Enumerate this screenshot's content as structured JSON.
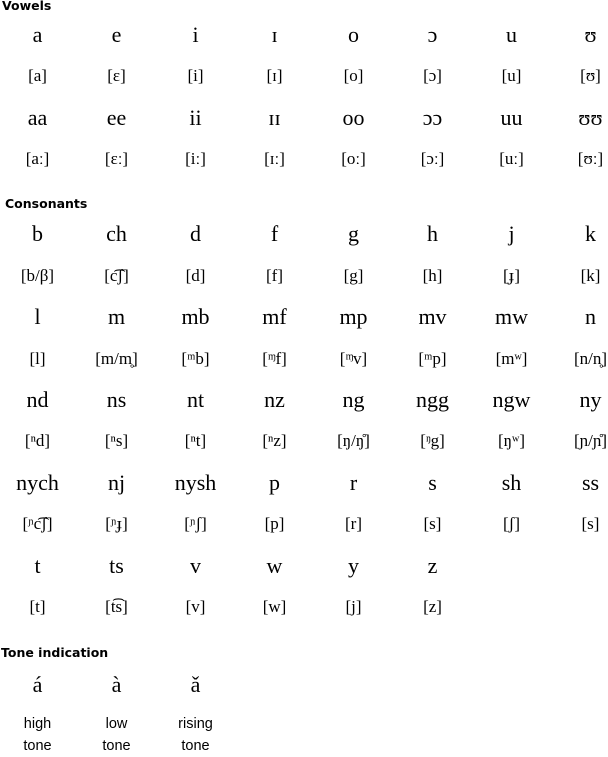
{
  "sections": {
    "vowels": {
      "heading": "Vowels",
      "rows": [
        {
          "type": "letter",
          "cells": [
            "a",
            "e",
            "i",
            "ɪ",
            "o",
            "ɔ",
            "u",
            "ʊ"
          ]
        },
        {
          "type": "ipa",
          "cells": [
            "[a]",
            "[ɛ]",
            "[i]",
            "[ɪ]",
            "[o]",
            "[ɔ]",
            "[u]",
            "[ʊ]"
          ]
        },
        {
          "type": "letter",
          "cells": [
            "aa",
            "ee",
            "ii",
            "ɪɪ",
            "oo",
            "ɔɔ",
            "uu",
            "ʊʊ"
          ]
        },
        {
          "type": "ipa",
          "cells": [
            "[aː]",
            "[ɛː]",
            "[iː]",
            "[ɪː]",
            "[oː]",
            "[ɔː]",
            "[uː]",
            "[ʊː]"
          ]
        }
      ]
    },
    "consonants": {
      "heading": "Consonants",
      "rows": [
        {
          "type": "letter",
          "cells": [
            "b",
            "ch",
            "d",
            "f",
            "g",
            "h",
            "j",
            "k"
          ]
        },
        {
          "type": "ipa",
          "cells": [
            "[b/β]",
            "[c͡ʃ]",
            "[d]",
            "[f]",
            "[g]",
            "[h]",
            "[ɟ]",
            "[k]"
          ]
        },
        {
          "type": "letter",
          "cells": [
            "l",
            "m",
            "mb",
            "mf",
            "mp",
            "mv",
            "mw",
            "n"
          ]
        },
        {
          "type": "ipa",
          "cells": [
            "[l]",
            "[m/m̥]",
            "[ᵐb]",
            "[ᶬf]",
            "[ᶬv]",
            "[ᵐp]",
            "[mʷ]",
            "[n/n̥]"
          ]
        },
        {
          "type": "letter",
          "cells": [
            "nd",
            "ns",
            "nt",
            "nz",
            "ng",
            "ngg",
            "ngw",
            "ny"
          ]
        },
        {
          "type": "ipa",
          "cells": [
            "[ⁿd]",
            "[ⁿs]",
            "[ⁿt]",
            "[ⁿz]",
            "[ŋ/ŋ̊]",
            "[ᵑg]",
            "[ŋʷ]",
            "[ɲ/ɲ̊]"
          ]
        },
        {
          "type": "letter",
          "cells": [
            "nych",
            "nj",
            "nysh",
            "p",
            "r",
            "s",
            "sh",
            "ss"
          ]
        },
        {
          "type": "ipa",
          "cells": [
            "[ᶮc͡ʃ]",
            "[ᶮɟ]",
            "[ᶮʃ]",
            "[p]",
            "[r]",
            "[s]",
            "[ʃ]",
            "[s]"
          ]
        },
        {
          "type": "letter",
          "cells": [
            "t",
            "ts",
            "v",
            "w",
            "y",
            "z"
          ]
        },
        {
          "type": "ipa",
          "cells": [
            "[t]",
            "[t͡s]",
            "[v]",
            "[w]",
            "[j]",
            "[z]"
          ]
        }
      ]
    },
    "tones": {
      "heading": "Tone indication",
      "items": [
        {
          "symbol": "á",
          "label_line1": "high",
          "label_line2": "tone"
        },
        {
          "symbol": "à",
          "label_line1": "low",
          "label_line2": "tone"
        },
        {
          "symbol": "ǎ",
          "label_line1": "rising",
          "label_line2": "tone"
        }
      ]
    }
  }
}
